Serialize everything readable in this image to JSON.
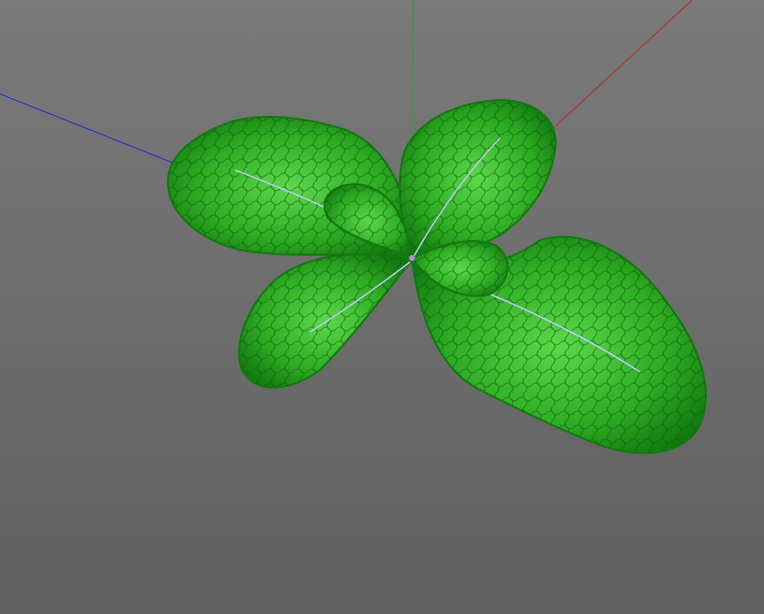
{
  "viewport": {
    "background_top": "#7a7a7a",
    "background_bottom": "#606060"
  },
  "axes": {
    "x_color": "#b03030",
    "y_color": "#2fa02f",
    "z_color": "#2a2ad0"
  },
  "model": {
    "leaf_light": "#5cd84a",
    "leaf_mid": "#2fae24",
    "leaf_dark": "#137a10",
    "vein_color": "#0d5a0a",
    "midrib_color": "#b9c8f0",
    "stem_color": "#b48ad0"
  }
}
